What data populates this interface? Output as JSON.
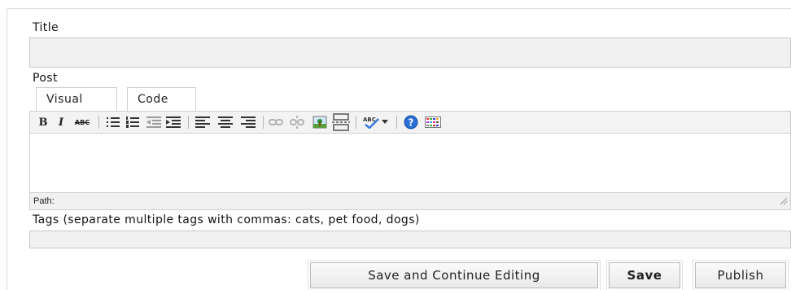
{
  "title_label": "Title",
  "post_label": "Post",
  "tabs": [
    {
      "label": "Visual",
      "active": true
    },
    {
      "label": "Code",
      "active": false
    }
  ],
  "toolbar": {
    "bold": "B",
    "italic": "I",
    "strike": "ABC",
    "icons": [
      "bold-icon",
      "italic-icon",
      "strikethrough-icon",
      "bullet-list-icon",
      "numbered-list-icon",
      "outdent-icon",
      "indent-icon",
      "align-left-icon",
      "align-center-icon",
      "align-right-icon",
      "link-icon",
      "unlink-icon",
      "image-icon",
      "more-break-icon",
      "spellcheck-icon",
      "dropdown-arrow-icon",
      "help-icon",
      "kitchen-sink-icon"
    ]
  },
  "path_label": "Path:",
  "tags_label": "Tags (separate multiple tags with commas: cats, pet food, dogs)",
  "buttons": {
    "save_continue": "Save and Continue Editing",
    "save": "Save",
    "publish": "Publish"
  },
  "colors": {
    "field_bg": "#f1f1f1",
    "toolbar_bg": "#f3f3f3",
    "help_blue": "#2a6fd6"
  }
}
